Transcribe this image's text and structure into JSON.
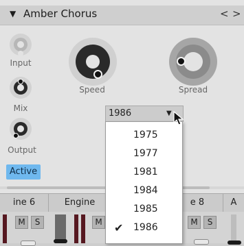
{
  "plugin": {
    "title": "Amber Chorus",
    "nav_prev": "<",
    "nav_next": ">",
    "active_label": "Active"
  },
  "knobs": {
    "input_label": "Input",
    "mix_label": "Mix",
    "output_label": "Output",
    "speed_label": "Speed",
    "spread_label": "Spread"
  },
  "dropdown": {
    "selected": "1986",
    "options": [
      "1975",
      "1977",
      "1981",
      "1984",
      "1985",
      "1986"
    ],
    "checked_index": 5,
    "check_glyph": "✔"
  },
  "mixer": {
    "channels": [
      {
        "name": "ine 6",
        "mute": "M",
        "solo": "S"
      },
      {
        "name": "Engine",
        "mute": "M"
      },
      {
        "name": "e 8",
        "mute": "M",
        "solo": "S"
      },
      {
        "name": "A"
      }
    ]
  },
  "colors": {
    "active_toggle": "#6fb8ee",
    "meter_red": "#561820"
  }
}
